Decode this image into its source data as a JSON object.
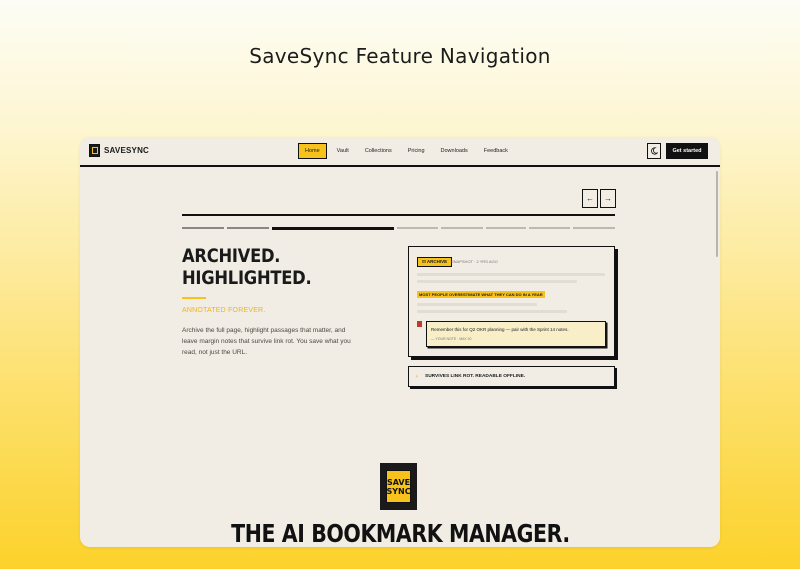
{
  "page_title": "SaveSync Feature Navigation",
  "nav": {
    "brand": "SAVESYNC",
    "links": [
      "Home",
      "Vault",
      "Collections",
      "Pricing",
      "Downloads",
      "Feedback"
    ],
    "active": "Home",
    "cta": "Get started",
    "theme_icon": "moon-icon"
  },
  "carousel": {
    "prev_icon": "arrow-left-icon",
    "next_icon": "arrow-right-icon",
    "prev_glyph": "←",
    "next_glyph": "→"
  },
  "hero": {
    "heading_line1": "ARCHIVED.",
    "heading_line2": "HIGHLIGHTED.",
    "subheading": "ANNOTATED FOREVER.",
    "description": "Archive the full page, highlight passages that matter, and leave margin notes that survive link rot. You save what you read, not just the URL."
  },
  "preview": {
    "tag": "ARCHIVE",
    "snapshot": "SNAPSHOT · 2 YRS AGO",
    "highlight": "MOST PEOPLE OVERESTIMATE WHAT THEY CAN DO IN A YEAR",
    "note_text": "Remember this for Q2 OKR planning — pair with the Sprint 14 notes.",
    "note_meta": "— YOUR NOTE · MAY 20",
    "banner": "SURVIVES LINK ROT. READABLE OFFLINE."
  },
  "bottom": {
    "logo_line1": "SAVE",
    "logo_line2": "SYNC",
    "tagline": "THE AI BOOKMARK MANAGER."
  },
  "colors": {
    "accent": "#f6c21b",
    "ink": "#111111",
    "paper": "#f1ede4"
  }
}
